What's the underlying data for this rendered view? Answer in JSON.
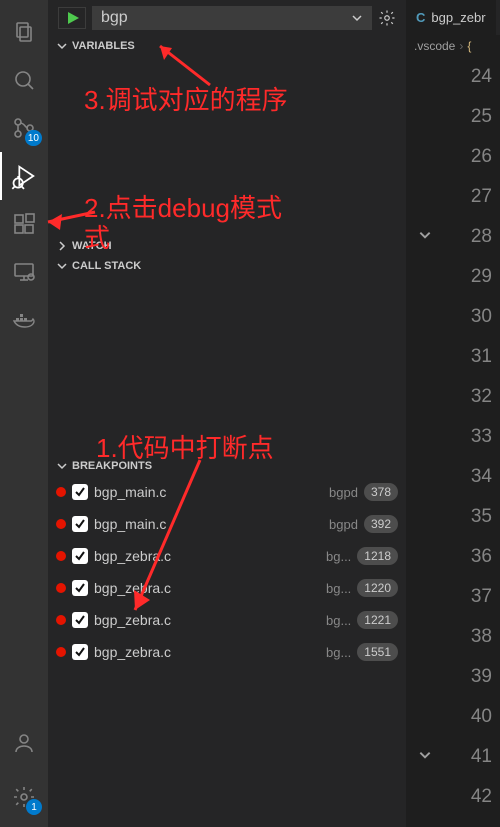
{
  "run": {
    "config_name": "bgp"
  },
  "activity": {
    "scm_badge": "10",
    "settings_badge": "1"
  },
  "sections": {
    "variables": "VARIABLES",
    "watch": "WATCH",
    "callstack": "CALL STACK",
    "breakpoints": "BREAKPOINTS"
  },
  "breakpoints": [
    {
      "file": "bgp_main.c",
      "folder": "bgpd",
      "line": "378"
    },
    {
      "file": "bgp_main.c",
      "folder": "bgpd",
      "line": "392"
    },
    {
      "file": "bgp_zebra.c",
      "folder": "bg...",
      "line": "1218"
    },
    {
      "file": "bgp_zebra.c",
      "folder": "bg...",
      "line": "1220"
    },
    {
      "file": "bgp_zebra.c",
      "folder": "bg...",
      "line": "1221"
    },
    {
      "file": "bgp_zebra.c",
      "folder": "bg...",
      "line": "1551"
    }
  ],
  "editor": {
    "tab_filename": "bgp_zebr",
    "crumb": ".vscode",
    "lines": [
      "24",
      "25",
      "26",
      "27",
      "28",
      "29",
      "30",
      "31",
      "32",
      "33",
      "34",
      "35",
      "36",
      "37",
      "38",
      "39",
      "40",
      "41",
      "42"
    ],
    "fold_at": [
      "28",
      "41"
    ]
  },
  "annotations": {
    "a3": "3.调试对应的程序",
    "a2": "2.点击debug模式",
    "a2b": "式",
    "a1": "1.代码中打断点"
  }
}
